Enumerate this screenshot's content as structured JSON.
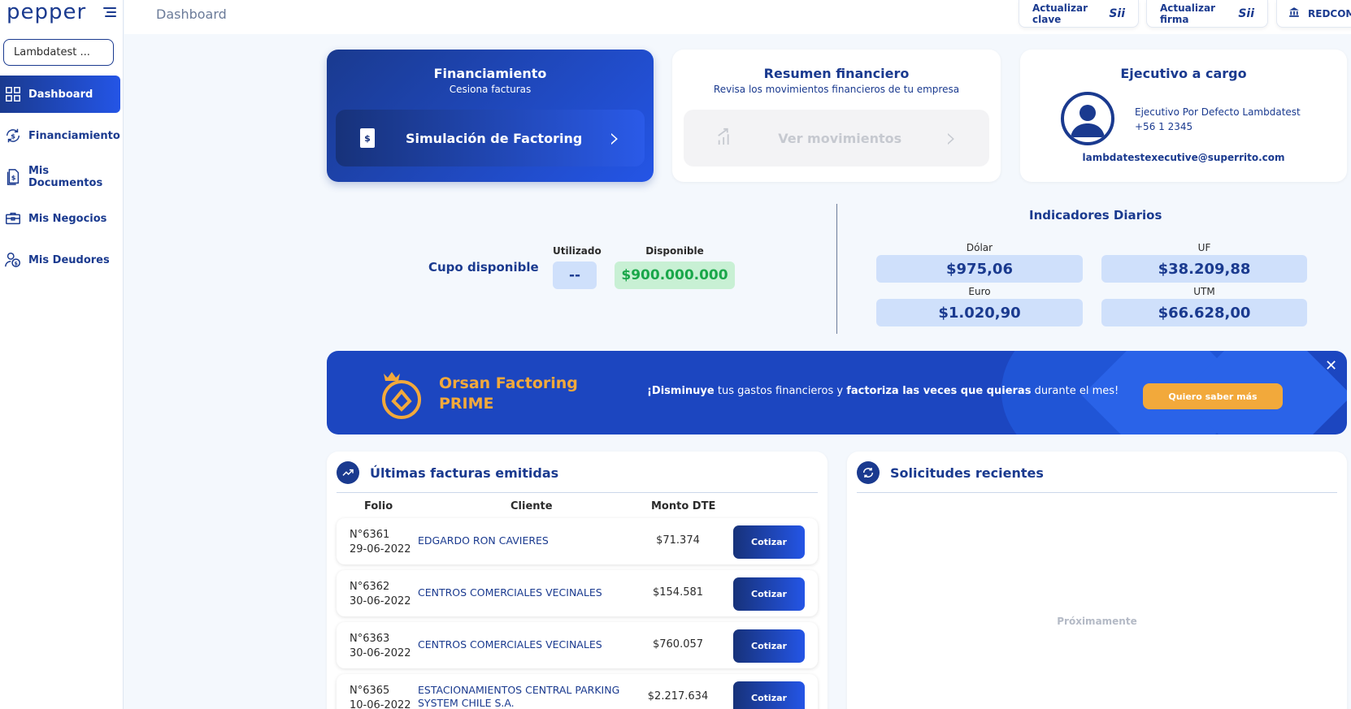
{
  "app": {
    "logo": "pepper",
    "page_title": "Dashboard"
  },
  "sidebar": {
    "company": "Lambdatest ...",
    "items": [
      {
        "label": "Dashboard",
        "icon": "grid-icon"
      },
      {
        "label": "Financiamiento",
        "icon": "money-cycle-icon"
      },
      {
        "label": "Mis Documentos",
        "icon": "document-dollar-icon"
      },
      {
        "label": "Mis Negocios",
        "icon": "briefcase-icon"
      },
      {
        "label": "Mis Deudores",
        "icon": "user-dollar-icon"
      }
    ]
  },
  "topbar": {
    "update_key": "Actualizar clave",
    "update_signature": "Actualizar firma",
    "sii": "Sii",
    "redcomercio": "REDCOM"
  },
  "financing": {
    "title": "Financiamiento",
    "subtitle": "Cesiona facturas",
    "button": "Simulación de Factoring",
    "doc_symbol": "$"
  },
  "summary": {
    "title": "Resumen financiero",
    "subtitle": "Revisa los movimientos financieros de tu empresa",
    "button": "Ver movimientos"
  },
  "executive": {
    "title": "Ejecutivo a cargo",
    "name": "Ejecutivo Por Defecto Lambdatest",
    "phone": "+56 1 2345",
    "email": "lambdatestexecutive@superrito.com"
  },
  "cupo": {
    "label": "Cupo disponible",
    "used_label": "Utilizado",
    "used_value": "--",
    "available_label": "Disponible",
    "available_value": "$900.000.000"
  },
  "indicators": {
    "title": "Indicadores Diarios",
    "items": [
      {
        "label": "Dólar",
        "value": "$975,06"
      },
      {
        "label": "UF",
        "value": "$38.209,88"
      },
      {
        "label": "Euro",
        "value": "$1.020,90"
      },
      {
        "label": "UTM",
        "value": "$66.628,00"
      }
    ]
  },
  "banner": {
    "brand_line1": "Orsan Factoring",
    "brand_line2": "PRIME",
    "msg_b1": "¡Disminuye",
    "msg_t1": " tus gastos financieros y ",
    "msg_b2": "factoriza las veces que quieras",
    "msg_t2": " durante el mes!",
    "button": "Quiero saber más",
    "close": "✕"
  },
  "invoices": {
    "title": "Últimas facturas emitidas",
    "columns": [
      "Folio",
      "Cliente",
      "Monto DTE"
    ],
    "action_label": "Cotizar",
    "rows": [
      {
        "folio": "N°6361",
        "date": "29-06-2022",
        "client": "EDGARDO RON CAVIERES",
        "amount": "$71.374"
      },
      {
        "folio": "N°6362",
        "date": "30-06-2022",
        "client": "CENTROS COMERCIALES VECINALES",
        "amount": "$154.581"
      },
      {
        "folio": "N°6363",
        "date": "30-06-2022",
        "client": "CENTROS COMERCIALES VECINALES",
        "amount": "$760.057"
      },
      {
        "folio": "N°6365",
        "date": "10-06-2022",
        "client": "ESTACIONAMIENTOS CENTRAL PARKING SYSTEM CHILE S.A.",
        "amount": "$2.217.634"
      }
    ]
  },
  "requests": {
    "title": "Solicitudes recientes",
    "empty": "Próximamente"
  },
  "colors": {
    "primary": "#1a3a8f",
    "accent": "#2455e6",
    "success_bg": "#c8f0d4",
    "success_text": "#1aa74a",
    "orange": "#f2a93b"
  }
}
